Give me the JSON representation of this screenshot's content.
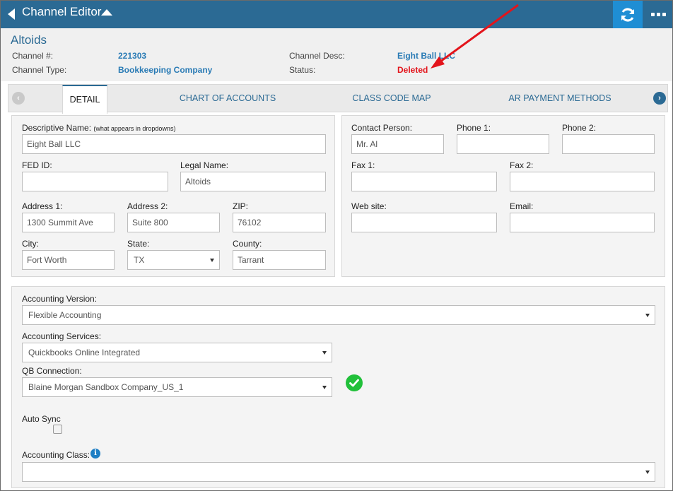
{
  "topbar": {
    "title": "Channel Editor",
    "back_icon": "chevron-left-icon",
    "collapse_icon": "caret-up-icon",
    "refresh_icon": "refresh-icon",
    "more_icon": "more-dots-icon",
    "color": "#2b6a94",
    "refresh_color": "#1f8ed4"
  },
  "header": {
    "name": "Altoids",
    "channel_num_label": "Channel #:",
    "channel_num": "221303",
    "channel_type_label": "Channel Type:",
    "channel_type": "Bookkeeping Company",
    "channel_desc_label": "Channel Desc:",
    "channel_desc": "Eight Ball LLC",
    "status_label": "Status:",
    "status": "Deleted",
    "status_color": "#e3141b"
  },
  "tabs": [
    {
      "label": "DETAIL",
      "active": true
    },
    {
      "label": "CHART OF ACCOUNTS",
      "active": false
    },
    {
      "label": "CLASS CODE MAP",
      "active": false
    },
    {
      "label": "AR PAYMENT METHODS",
      "active": false
    }
  ],
  "detail": {
    "descriptive_name_label": "Descriptive Name:",
    "descriptive_name_hint": "(what appears in dropdowns)",
    "descriptive_name": "Eight Ball LLC",
    "fed_id_label": "FED ID:",
    "fed_id": "",
    "legal_name_label": "Legal Name:",
    "legal_name": "Altoids",
    "address1_label": "Address 1:",
    "address1": "1300 Summit Ave",
    "address2_label": "Address 2:",
    "address2": "Suite 800",
    "zip_label": "ZIP:",
    "zip": "76102",
    "city_label": "City:",
    "city": "Fort Worth",
    "state_label": "State:",
    "state": "TX",
    "county_label": "County:",
    "county": "Tarrant"
  },
  "contact": {
    "contact_person_label": "Contact Person:",
    "contact_person": "Mr. Al",
    "phone1_label": "Phone 1:",
    "phone1": "",
    "phone2_label": "Phone 2:",
    "phone2": "",
    "fax1_label": "Fax 1:",
    "fax1": "",
    "fax2_label": "Fax 2:",
    "fax2": "",
    "website_label": "Web site:",
    "website": "",
    "email_label": "Email:",
    "email": ""
  },
  "accounting": {
    "version_label": "Accounting Version:",
    "version": "Flexible Accounting",
    "services_label": "Accounting Services:",
    "services": "Quickbooks Online Integrated",
    "qb_connection_label": "QB Connection:",
    "qb_connection": "Blaine Morgan Sandbox Company_US_1",
    "qb_status_icon": "check-circle-icon",
    "auto_sync_label": "Auto Sync",
    "auto_sync": false,
    "class_label": "Accounting Class:",
    "class": ""
  },
  "annotation": {
    "arrow_color": "#e3141b"
  }
}
